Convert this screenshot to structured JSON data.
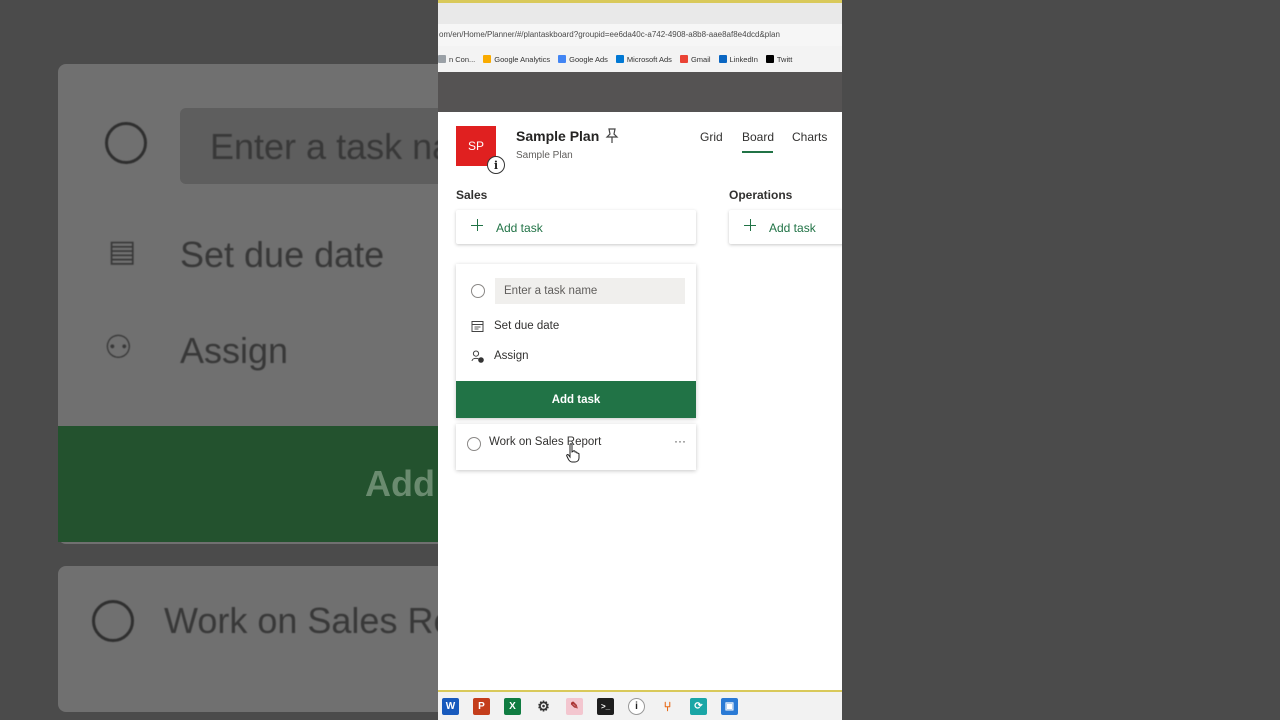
{
  "background": {
    "input_placeholder": "Enter a task na",
    "due_label": "Set due date",
    "assign_label": "Assign",
    "add_label": "Add",
    "task_label": "Work on Sales Re"
  },
  "browser": {
    "url": "om/en/Home/Planner/#/plantaskboard?groupid=ee6da40c-a742-4908-a8b8-aae8af8e4dcd&plan",
    "bookmarks": [
      {
        "label": "n Con...",
        "icon": "doc-icon",
        "color": "#9aa0a6"
      },
      {
        "label": "Google Analytics",
        "icon": "analytics-icon",
        "color": "#f9ab00"
      },
      {
        "label": "Google Ads",
        "icon": "ads-icon",
        "color": "#4285f4"
      },
      {
        "label": "Microsoft Ads",
        "icon": "msads-icon",
        "color": "#0078d4"
      },
      {
        "label": "Gmail",
        "icon": "gmail-icon",
        "color": "#ea4335"
      },
      {
        "label": "LinkedIn",
        "icon": "linkedin-icon",
        "color": "#0a66c2"
      },
      {
        "label": "Twitt",
        "icon": "x-icon",
        "color": "#000000"
      }
    ]
  },
  "plan": {
    "icon_text": "SP",
    "icon_color": "#e02020",
    "title": "Sample Plan",
    "subtitle": "Sample Plan",
    "views": [
      "Grid",
      "Board",
      "Charts"
    ],
    "active_view": "Board"
  },
  "buckets": [
    {
      "name": "Sales",
      "add_label": "Add task"
    },
    {
      "name": "Operations",
      "add_label": "Add task"
    }
  ],
  "new_task": {
    "placeholder": "Enter a task name",
    "due_label": "Set due date",
    "assign_label": "Assign",
    "button_label": "Add task"
  },
  "tasks": [
    {
      "name": "Work on Sales Report",
      "more": "···"
    }
  ],
  "accent_color": "#217346",
  "taskbar_icons": [
    "word-icon",
    "powerpoint-icon",
    "excel-icon",
    "settings-icon",
    "paint-icon",
    "terminal-icon",
    "info-icon",
    "git-icon",
    "sync-icon",
    "remote-icon"
  ]
}
